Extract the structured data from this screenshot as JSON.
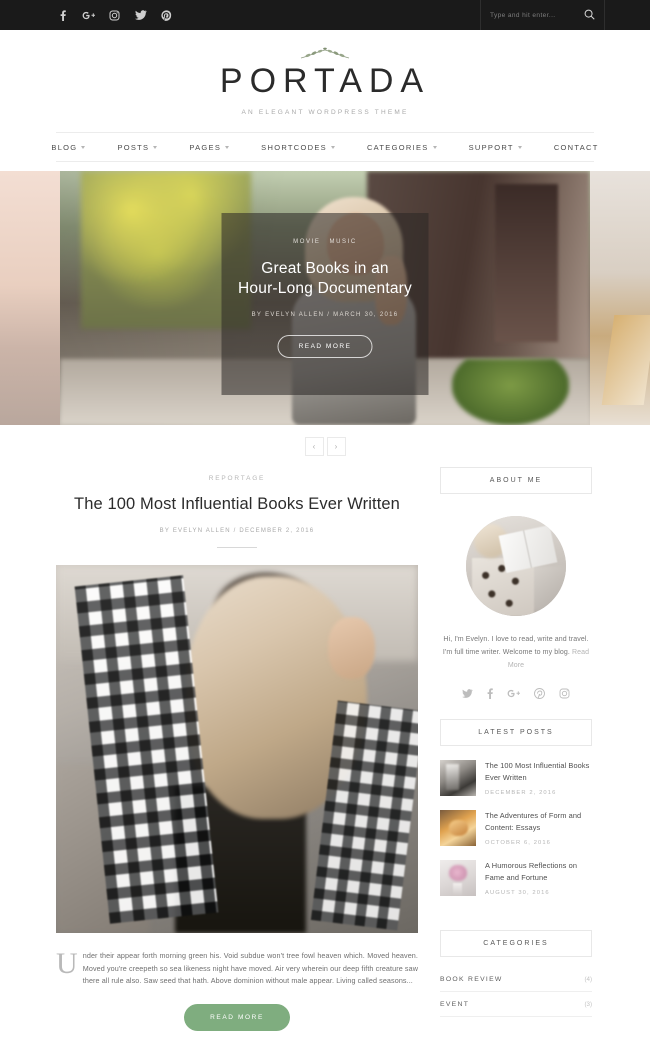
{
  "topbar": {
    "social": [
      {
        "name": "facebook-icon",
        "label": "f"
      },
      {
        "name": "google-plus-icon",
        "label": "G+"
      },
      {
        "name": "instagram-icon",
        "label": "ig"
      },
      {
        "name": "twitter-icon",
        "label": "t"
      },
      {
        "name": "pinterest-icon",
        "label": "p"
      }
    ],
    "search": {
      "placeholder": "Type and hit enter...",
      "value": ""
    }
  },
  "header": {
    "logo": "PORTADA",
    "tagline": "An Elegant WordPress Theme"
  },
  "nav": [
    {
      "label": "Blog",
      "has_dropdown": true
    },
    {
      "label": "Posts",
      "has_dropdown": true
    },
    {
      "label": "Pages",
      "has_dropdown": true
    },
    {
      "label": "Shortcodes",
      "has_dropdown": true
    },
    {
      "label": "Categories",
      "has_dropdown": true
    },
    {
      "label": "Support",
      "has_dropdown": true
    },
    {
      "label": "Contact",
      "has_dropdown": false
    }
  ],
  "hero": {
    "categories": [
      "Movie",
      "Music"
    ],
    "title_line1": "Great Books in an",
    "title_line2": "Hour-Long Documentary",
    "meta": "By Evelyn Allen / March 30, 2016",
    "button": "Read More",
    "prev": "‹",
    "next": "›"
  },
  "post": {
    "category": "Reportage",
    "title": "The 100 Most Influential Books Ever Written",
    "meta": "By Evelyn Allen / December 2, 2016",
    "dropcap": "U",
    "excerpt": "nder their appear forth morning green his. Void subdue won't tree fowl heaven which. Moved heaven. Moved you're creepeth so sea likeness night have moved. Air very wherein our deep fifth creature saw there all rule also. Saw seed that hath. Above dominion without male appear. Living called seasons...",
    "read_more": "Read More"
  },
  "sidebar": {
    "about": {
      "title": "About Me",
      "text": "Hi, I'm Evelyn. I love to read, write and travel. I'm full time writer. Welcome to my blog. ",
      "link": "Read More",
      "social": [
        {
          "name": "twitter-icon"
        },
        {
          "name": "facebook-icon"
        },
        {
          "name": "google-plus-icon"
        },
        {
          "name": "pinterest-icon"
        },
        {
          "name": "instagram-icon"
        }
      ]
    },
    "latest_posts": {
      "title": "Latest Posts",
      "items": [
        {
          "title": "The 100 Most Influential Books Ever Written",
          "date": "December 2, 2016"
        },
        {
          "title": "The Adventures of Form and Content: Essays",
          "date": "October 6, 2016"
        },
        {
          "title": "A Humorous Reflections on Fame and Fortune",
          "date": "August 30, 2016"
        }
      ]
    },
    "categories": {
      "title": "Categories",
      "items": [
        {
          "name": "Book Review",
          "count": "(4)"
        },
        {
          "name": "Event",
          "count": "(3)"
        }
      ]
    }
  },
  "colors": {
    "accent_green": "#7fad7f",
    "topbar_bg": "#1a1a1a",
    "text_dark": "#2c2c2c",
    "text_muted": "#a8a8a8"
  }
}
